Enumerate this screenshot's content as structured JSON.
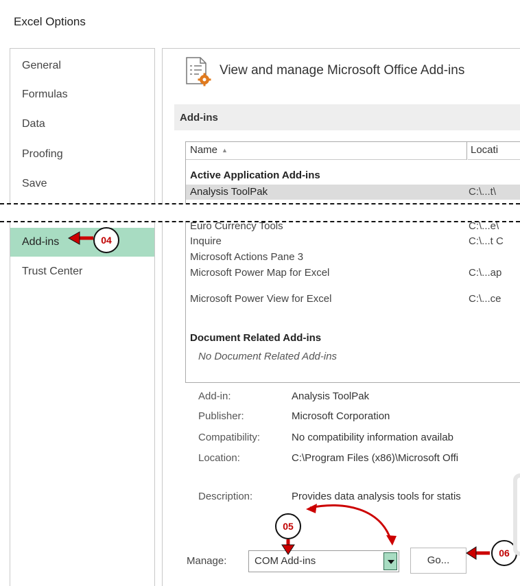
{
  "window": {
    "title": "Excel Options"
  },
  "sidebar": {
    "items": [
      {
        "label": "General"
      },
      {
        "label": "Formulas"
      },
      {
        "label": "Data"
      },
      {
        "label": "Proofing"
      },
      {
        "label": "Save"
      },
      {
        "label": "Add-ins"
      },
      {
        "label": "Trust Center"
      }
    ],
    "active": "Add-ins"
  },
  "main": {
    "header": "View and manage Microsoft Office Add-ins",
    "section_title": "Add-ins",
    "columns": {
      "name": "Name",
      "location": "Locati"
    },
    "rows": [
      {
        "name": "Active Application Add-ins",
        "location": "",
        "type": "group"
      },
      {
        "name": "Analysis ToolPak",
        "location": "C:\\...t\\",
        "type": "selected"
      },
      {
        "name": "Euro Currency Tools",
        "location": "C:\\...e\\",
        "type": "item"
      },
      {
        "name": "Inquire",
        "location": "C:\\...t C",
        "type": "item"
      },
      {
        "name": "Microsoft Actions Pane 3",
        "location": "",
        "type": "item"
      },
      {
        "name": "Microsoft Power Map for Excel",
        "location": "C:\\...ap",
        "type": "item"
      },
      {
        "name": "Microsoft Power View for Excel",
        "location": "C:\\...ce",
        "type": "item"
      },
      {
        "name": "Document Related Add-ins",
        "location": "",
        "type": "group"
      },
      {
        "name": "No Document Related Add-ins",
        "location": "",
        "type": "empty"
      }
    ],
    "details": {
      "addin_label": "Add-in:",
      "addin_value": "Analysis ToolPak",
      "publisher_label": "Publisher:",
      "publisher_value": "Microsoft Corporation",
      "compat_label": "Compatibility:",
      "compat_value": "No compatibility information availab",
      "location_label": "Location:",
      "location_value": "C:\\Program Files (x86)\\Microsoft Offi",
      "desc_label": "Description:",
      "desc_value": "Provides data analysis tools for statis"
    },
    "manage": {
      "label": "Manage:",
      "value": "COM Add-ins",
      "go_label": "Go..."
    }
  },
  "annotations": {
    "step4": "04",
    "step5": "05",
    "step6": "06"
  },
  "colors": {
    "accent": "#a8dcc2",
    "arrow": "#cc0000",
    "badge_text": "#c00000"
  },
  "icons": {
    "header": "addins-gear-document-icon",
    "dropdown": "chevron-down-icon"
  }
}
